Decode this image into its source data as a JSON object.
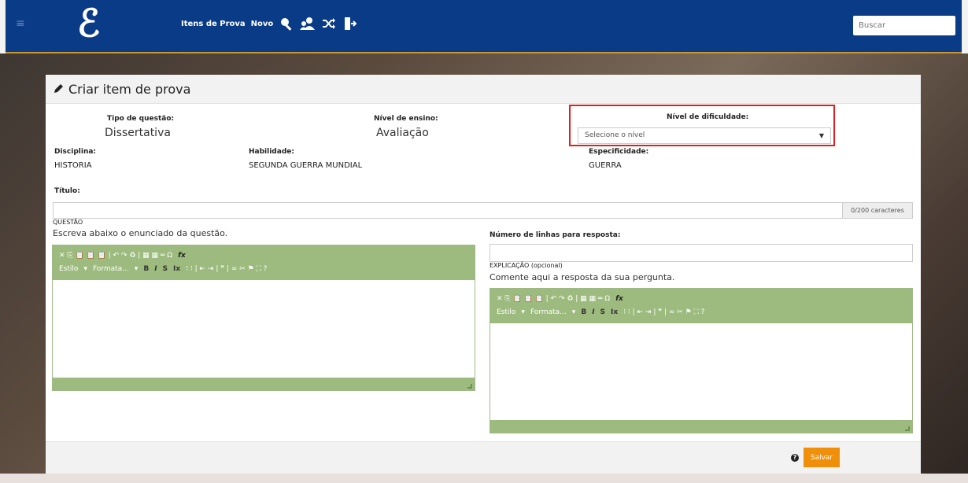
{
  "nav": {
    "logo": "ℰ",
    "menu_icon": "hamburger-icon",
    "items_label": "Itens de Prova",
    "new_label": "Novo",
    "icons": [
      "search-icon",
      "users-icon",
      "shuffle-icon",
      "logout-icon"
    ],
    "search_placeholder": "Buscar"
  },
  "card": {
    "title": "Criar item de prova",
    "title_icon": "pencil-icon"
  },
  "fields": {
    "tipo_label": "Tipo de questão:",
    "tipo_value": "Dissertativa",
    "nivel_ensino_label": "Nível de ensino:",
    "nivel_ensino_value": "Avaliação",
    "dificuldade_label": "Nível de dificuldade:",
    "dificuldade_select": "Selecione o nível",
    "disciplina_label": "Disciplina:",
    "disciplina_value": "HISTORIA",
    "habilidade_label": "Habilidade:",
    "habilidade_value": "SEGUNDA GUERRA MUNDIAL",
    "especificidade_label": "Especificidade:",
    "especificidade_value": "GUERRA",
    "titulo_label": "Título:",
    "titulo_counter": "0/200 caracteres"
  },
  "questao": {
    "section_label": "QUESTÃO",
    "instruction": "Escreva abaixo o enunciado da questão."
  },
  "resposta": {
    "linhas_label": "Número de linhas para resposta:",
    "explicacao_label": "EXPLICAÇÃO (opcional)",
    "explicacao_instruction": "Comente aqui a resposta da sua pergunta."
  },
  "toolbar": {
    "row1": "✕ ⎘ 📋 📋 📋 | ↶ ↷ ♻ | ▦ ▦ ═ Ω",
    "fx": "fx",
    "style_label": "Estilo",
    "format_label": "Formata...",
    "bold": "B",
    "italic": "I",
    "strike": "S",
    "clear_format": "Ix",
    "row2_rest": "⁝ ⁝ | ⇤ ⇥ | ❞ | ∞ ✂ ⚑ ⛶ ?"
  },
  "footer": {
    "save_label": "Salvar",
    "help_icon": "help-icon"
  },
  "colors": {
    "topbar": "#0a3b86",
    "editor_toolbar": "#9dbb7e",
    "save_button": "#f0900a",
    "highlight": "#e02020"
  }
}
